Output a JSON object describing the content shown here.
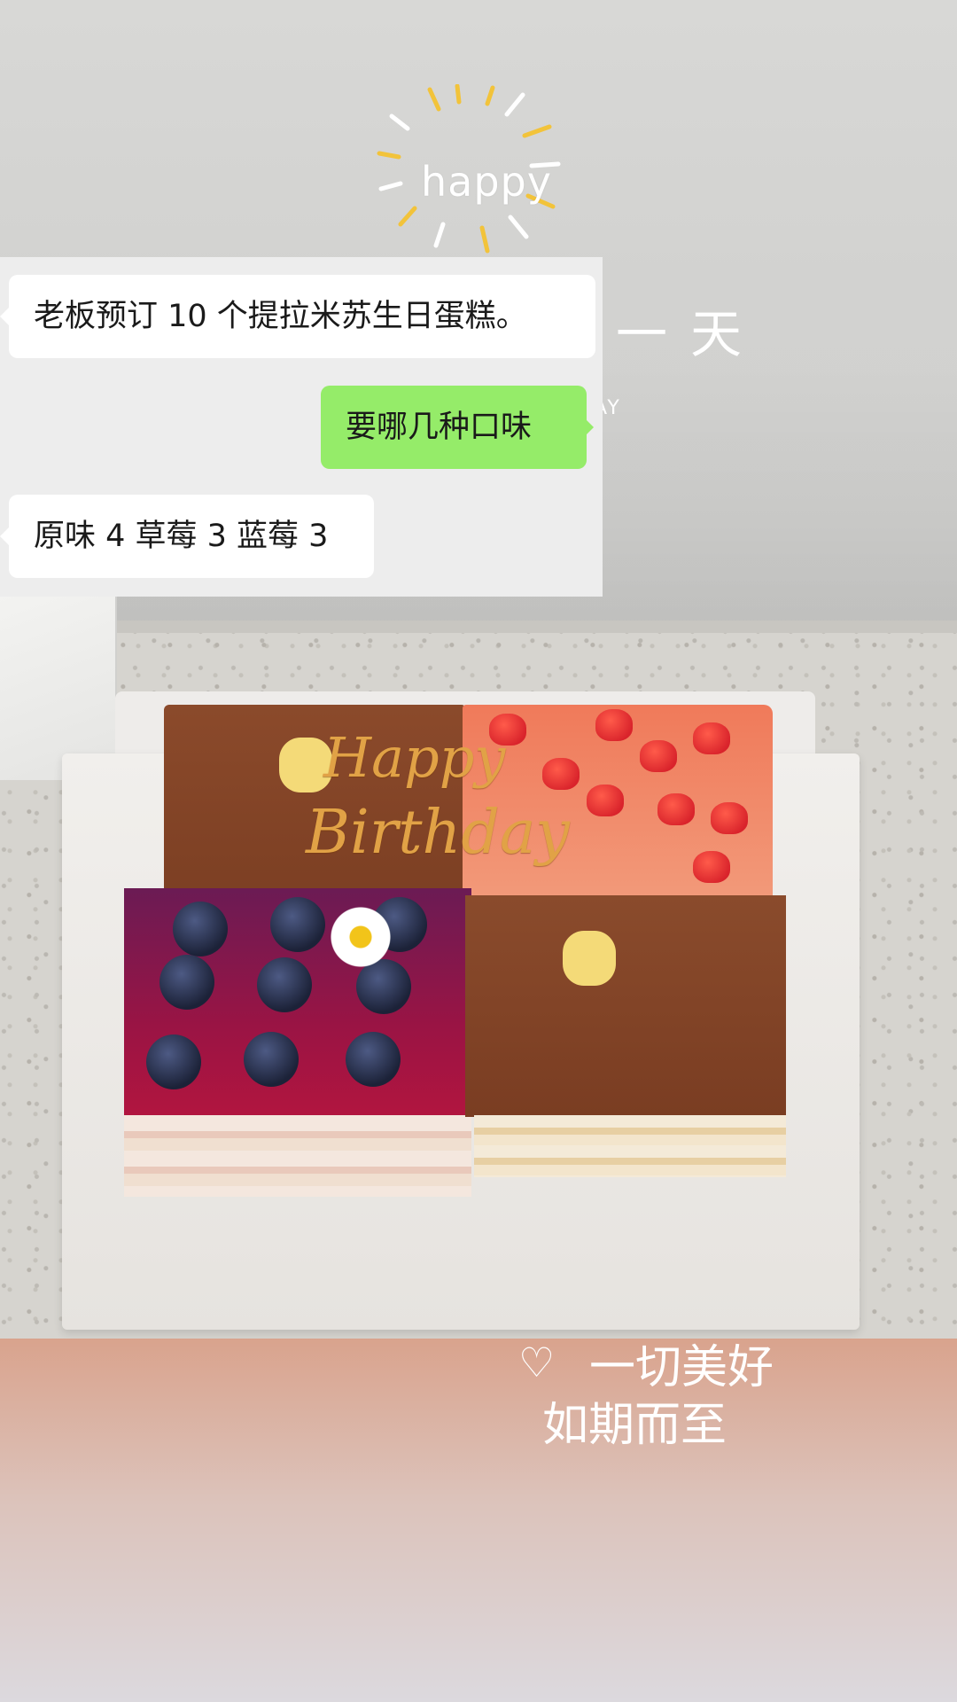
{
  "chat": {
    "messages": [
      {
        "side": "left",
        "text": "老板预订 10 个提拉米苏生日蛋糕。"
      },
      {
        "side": "right",
        "text": "要哪几种口味"
      },
      {
        "side": "left",
        "text": "原味 4 草莓 3 蓝莓 3"
      }
    ],
    "colors": {
      "incoming": "#ffffff",
      "outgoing": "#95ec69",
      "background": "#ededed"
    }
  },
  "decorations": {
    "happy": "happy",
    "day_text": "一天",
    "day_sub": "AY",
    "topper_line1": "Happy",
    "topper_line2": "Birthday",
    "bottom_line1": "一切美好",
    "bottom_line2": "如期而至"
  },
  "icons": [
    "sun-rays-icon",
    "heart-doodle-icon",
    "blueberry-icon",
    "strawberry-icon",
    "bear-decoration-icon",
    "daisy-icon"
  ]
}
